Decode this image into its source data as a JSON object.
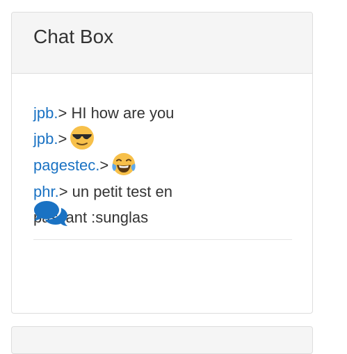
{
  "panel": {
    "title": "Chat Box"
  },
  "messages": [
    {
      "user": "jpb.",
      "sep": ">",
      "text": " HI how are you",
      "emoji": null
    },
    {
      "user": "jpb.",
      "sep": ">",
      "text": "",
      "emoji": "sunglasses-emoji"
    },
    {
      "user": "pagestec.",
      "sep": ">",
      "text": "",
      "emoji": "tears-of-joy-emoji"
    },
    {
      "user": "phr.",
      "sep": ">",
      "text": " un petit test en passant :sunglas",
      "emoji": null
    }
  ],
  "icons": {
    "chat": "comments-icon"
  },
  "colors": {
    "link": "#1a72c3",
    "heading_bg": "#f5f5f5",
    "border": "#dddddd",
    "text": "#333333"
  }
}
